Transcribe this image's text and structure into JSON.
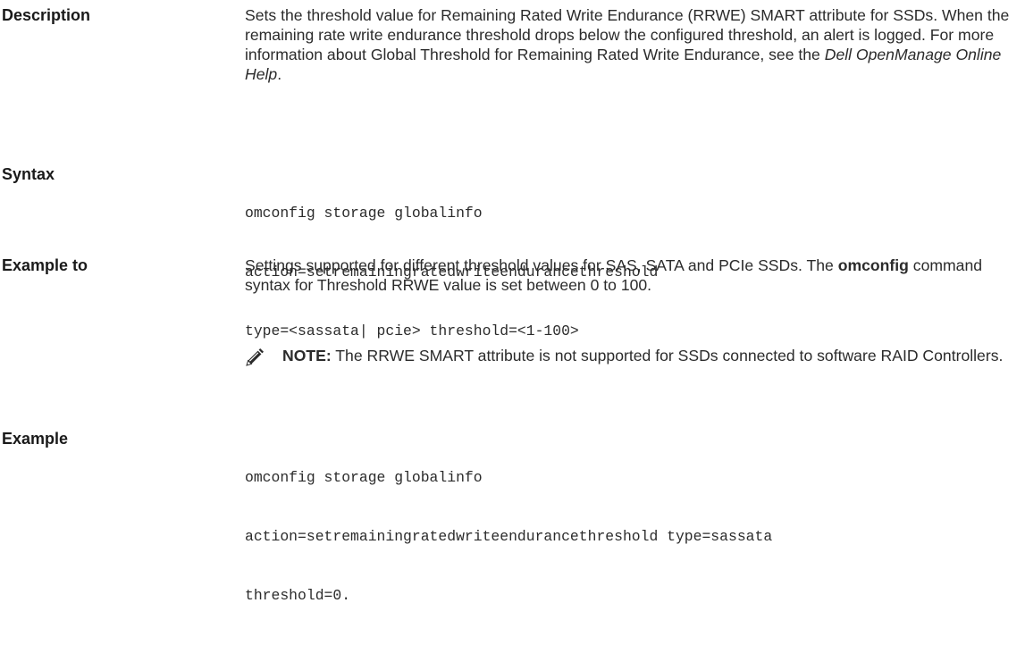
{
  "description": {
    "term": "Description",
    "text_before": "Sets the threshold value for Remaining Rated Write Endurance (RRWE) SMART attribute for SSDs. When the remaining rate write endurance threshold drops below the configured threshold, an alert is logged. For more information about Global Threshold for Remaining Rated Write Endurance, see the ",
    "text_italic": "Dell OpenManage Online Help",
    "text_after": "."
  },
  "syntax": {
    "term": "Syntax",
    "lines": [
      "omconfig storage globalinfo",
      "action=setremainingratedwriteendurancethreshold",
      "type=<sassata| pcie> threshold=<1-100>"
    ]
  },
  "example_to": {
    "term": "Example to",
    "text_before": "Settings supported for different threshold values for SAS, SATA and PCIe SSDs. The ",
    "text_bold": "omconfig",
    "text_after": " command syntax for Threshold RRWE value is set between 0 to 100."
  },
  "note": {
    "icon": "pencil-note-icon",
    "label": "NOTE:",
    "text": " The RRWE SMART attribute is not supported for SSDs connected to software RAID Controllers."
  },
  "example": {
    "term": "Example",
    "lines": [
      "omconfig storage globalinfo",
      "action=setremainingratedwriteendurancethreshold type=sassata",
      "threshold=0."
    ]
  }
}
